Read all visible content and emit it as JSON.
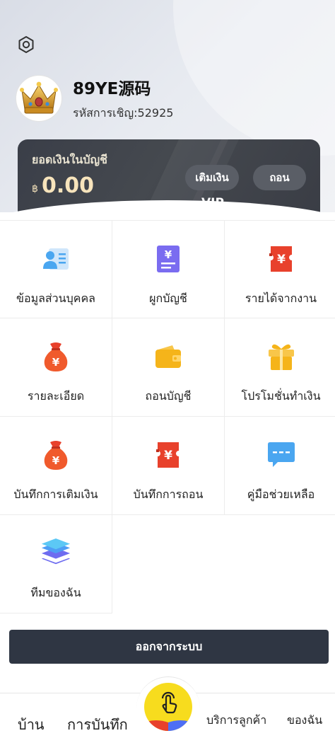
{
  "profile": {
    "username": "89YE源码",
    "invite_code": "รหัสการเชิญ:52925"
  },
  "balance_card": {
    "label": "ยอดเงินในบัญชี",
    "currency_symbol": "฿",
    "amount": "0.00",
    "deposit_label": "เติมเงิน",
    "withdraw_label": "ถอน",
    "vip_label": "VIP"
  },
  "menu": [
    {
      "label": "ข้อมูลส่วนบุคคล",
      "icon": "profile-card-icon",
      "color": "#4aa6f0"
    },
    {
      "label": "ผูกบัญชี",
      "icon": "bank-document-icon",
      "color": "#6c5ce7"
    },
    {
      "label": "รายได้จากงาน",
      "icon": "red-ticket-icon",
      "color": "#e8412c"
    },
    {
      "label": "รายละเอียด",
      "icon": "money-bag-icon",
      "color": "#e8412c"
    },
    {
      "label": "ถอนบัญชี",
      "icon": "wallet-icon",
      "color": "#f5b41a"
    },
    {
      "label": "โปรโมชั่นทำเงิน",
      "icon": "gift-icon",
      "color": "#f5b41a"
    },
    {
      "label": "บันทึกการเติมเงิน",
      "icon": "money-bag-icon",
      "color": "#e8412c"
    },
    {
      "label": "บันทึกการถอน",
      "icon": "red-ticket-icon",
      "color": "#e8412c"
    },
    {
      "label": "คู่มือช่วยเหลือ",
      "icon": "chat-bubble-icon",
      "color": "#4aa6f0"
    },
    {
      "label": "ทีมของฉัน",
      "icon": "layers-icon",
      "color": "#5b7cf0"
    }
  ],
  "logout_label": "ออกจากระบบ",
  "nav": {
    "home": "บ้าน",
    "record": "การบันทึก",
    "service": "บริการลูกค้า",
    "mine": "ของฉัน"
  }
}
